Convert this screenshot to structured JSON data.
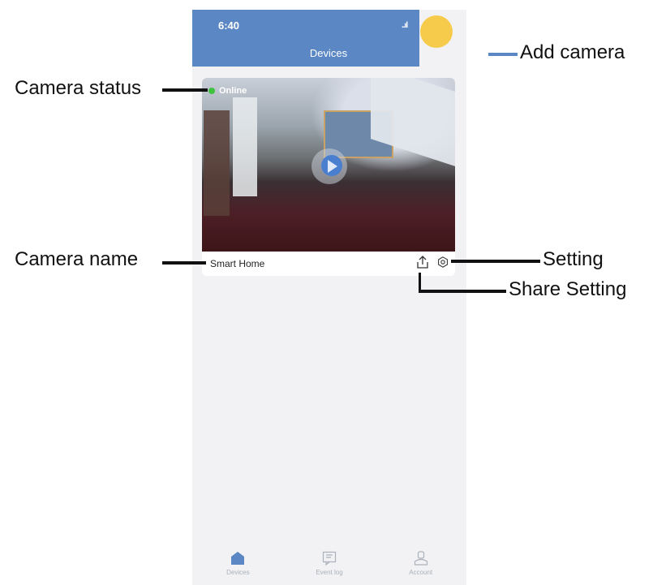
{
  "status_bar": {
    "time": "6:40",
    "signal": "..ıl"
  },
  "header": {
    "title": "Devices"
  },
  "camera": {
    "status": "Online",
    "name": "Smart Home"
  },
  "tabbar": {
    "tabs": [
      {
        "label": "Devices",
        "icon": "home-icon"
      },
      {
        "label": "Event log",
        "icon": "message-icon"
      },
      {
        "label": "Account",
        "icon": "user-icon"
      }
    ]
  },
  "annotations": {
    "add_camera": "Add camera",
    "camera_status": "Camera status",
    "camera_name": "Camera name",
    "setting": "Setting",
    "share_setting": "Share Setting"
  },
  "colors": {
    "header": "#5b87c4",
    "online": "#3fc33f",
    "add_button": "#f5c842",
    "active_tab": "#5b87c4"
  }
}
